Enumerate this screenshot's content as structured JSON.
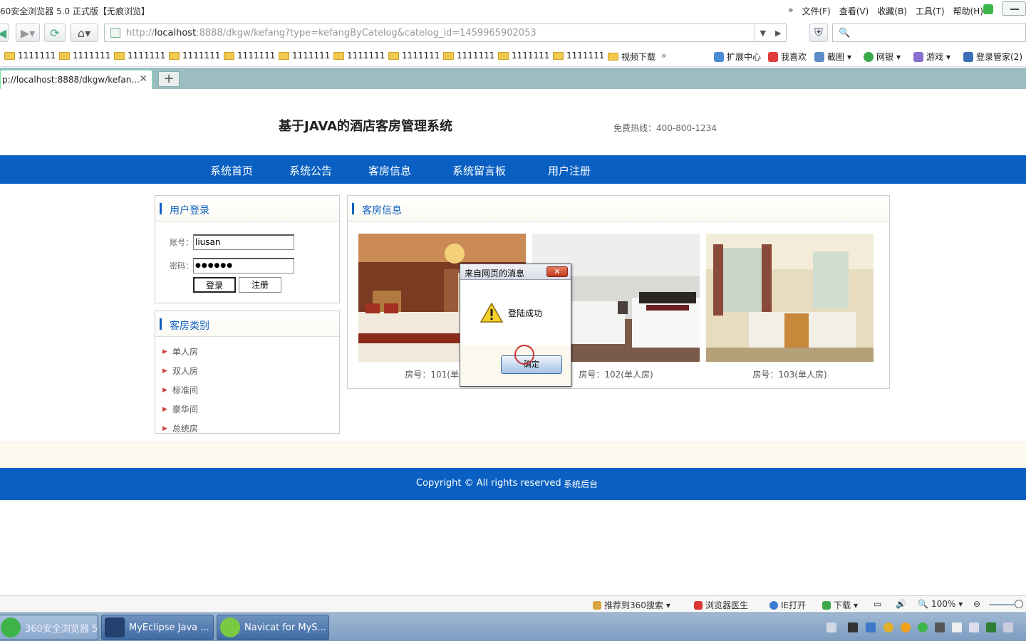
{
  "browser": {
    "window_title": "60安全浏览器 5.0 正式版【无痕浏览】",
    "menus": [
      "文件(F)",
      "查看(V)",
      "收藏(B)",
      "工具(T)",
      "帮助(H)"
    ],
    "url_prefix": "http://",
    "url_host": "localhost",
    "url_rest": ":8888/dkgw/kefang?type=kefangByCatelog&catelog_id=1459965902053",
    "search_placeholder": "",
    "favorites": [
      "1111111",
      "1111111",
      "1111111",
      "1111111",
      "1111111",
      "1111111",
      "1111111",
      "1111111",
      "1111111",
      "1111111",
      "1111111",
      "视频下载"
    ],
    "fav_more": "»",
    "tools": [
      "扩展中心",
      "我喜欢",
      "截图",
      "网银",
      "游戏",
      "登录管家(2)"
    ],
    "tab_label": "p://localhost:8888/dkgw/kefan...",
    "tab_close": "✕",
    "new_tab": "+"
  },
  "site": {
    "title": "基于JAVA的酒店客房管理系统",
    "hotline": "免费热线：400-800-1234",
    "nav": [
      "系统首页",
      "系统公告",
      "客房信息",
      "系统留言板",
      "用户注册"
    ]
  },
  "login": {
    "heading": "用户登录",
    "username_label": "账号：",
    "username_value": "liusan",
    "password_label": "密码：",
    "password_value": "●●●●●●",
    "login_button": "登录",
    "register_button": "注册"
  },
  "categories": {
    "heading": "客房类别",
    "items": [
      "单人房",
      "双人房",
      "标准间",
      "豪华间",
      "总统房"
    ]
  },
  "rooms": {
    "heading": "客房信息",
    "items": [
      {
        "caption": "房号：101(单人房)"
      },
      {
        "caption": "房号：102(单人房)"
      },
      {
        "caption": "房号：103(单人房)"
      }
    ]
  },
  "footer": {
    "copyright": "Copyright © All rights reserved",
    "admin_link": "系统后台"
  },
  "dialog": {
    "title": "来自网页的消息",
    "close": "✕",
    "message": "登陆成功",
    "ok": "确定"
  },
  "statusbar": {
    "items": [
      "推荐到360搜索",
      "浏览器医生",
      "IE打开",
      "下载"
    ],
    "zoom": "100%"
  },
  "taskbar": {
    "tasks": [
      "360安全浏览器 5....",
      "MyEclipse Java ...",
      "Navicat for MyS..."
    ]
  },
  "colors": {
    "brand_blue": "#0a60c2",
    "heading_blue": "#1060c0",
    "tab_bar": "#9cbdc0"
  }
}
